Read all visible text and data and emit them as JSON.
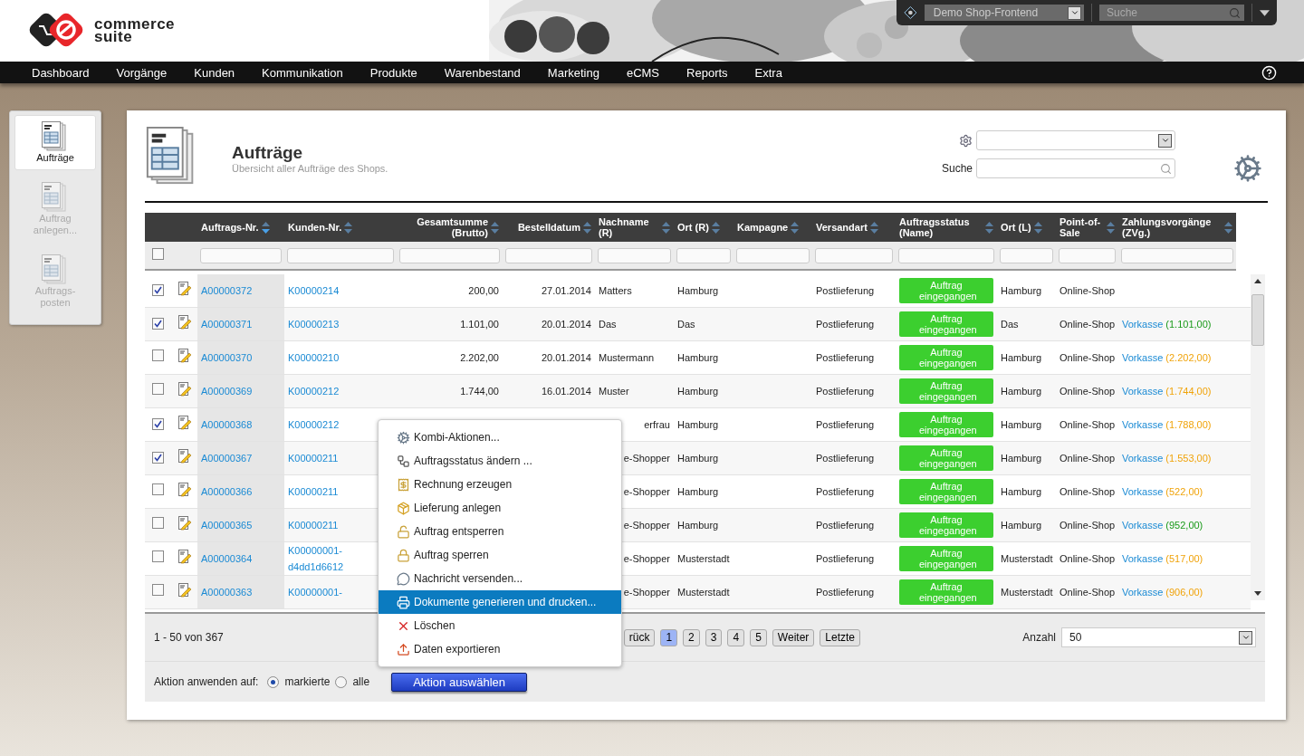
{
  "brand": {
    "line_1": "commerce",
    "line_2": "suite"
  },
  "shop_bar": {
    "shop_select": "Demo Shop-Frontend",
    "search_placeholder": "Suche"
  },
  "nav": {
    "items": [
      "Dashboard",
      "Vorgänge",
      "Kunden",
      "Kommunikation",
      "Produkte",
      "Warenbestand",
      "Marketing",
      "eCMS",
      "Reports",
      "Extra"
    ]
  },
  "sidebar": {
    "items": [
      {
        "label": "Aufträge",
        "selected": true,
        "disabled": false
      },
      {
        "label": "Auftrag anlegen...",
        "selected": false,
        "disabled": true
      },
      {
        "label": "Auftrags-posten",
        "selected": false,
        "disabled": true
      }
    ]
  },
  "page": {
    "title": "Aufträge",
    "subtitle": "Übersicht aller Aufträge des Shops.",
    "search_label": "Suche"
  },
  "table": {
    "select_all_checked": false,
    "columns": [
      {
        "label": "Auftrags-Nr.",
        "sorted": true
      },
      {
        "label": "Kunden-Nr.",
        "sorted": false
      },
      {
        "label": "Gesamtsumme (Brutto)",
        "sorted": false
      },
      {
        "label": "Bestelldatum",
        "sorted": false
      },
      {
        "label": "Nachname (R)",
        "sorted": false
      },
      {
        "label": "Ort (R)",
        "sorted": false
      },
      {
        "label": "Kampagne",
        "sorted": false
      },
      {
        "label": "Versandart",
        "sorted": false
      },
      {
        "label": "Auftragsstatus (Name)",
        "sorted": false
      },
      {
        "label": "Ort (L)",
        "sorted": false
      },
      {
        "label": "Point-of-Sale",
        "sorted": false
      },
      {
        "label": "Zahlungsvorgänge (ZVg.)",
        "sorted": false
      }
    ],
    "rows": [
      {
        "checked": true,
        "order": "A00000372",
        "customer": "K00000214",
        "total": "200,00",
        "date": "27.01.2014",
        "name": "Matters",
        "name_covered": false,
        "city_r": "Hamburg",
        "shipping": "Postlieferung",
        "status": "Auftrag eingegangen",
        "city_l": "Hamburg",
        "pos": "Online-Shop"
      },
      {
        "checked": true,
        "order": "A00000371",
        "customer": "K00000213",
        "total": "1.101,00",
        "date": "20.01.2014",
        "name": "Das",
        "name_covered": false,
        "city_r": "Das",
        "shipping": "Postlieferung",
        "status": "Auftrag eingegangen",
        "city_l": "Das",
        "pos": "Online-Shop",
        "payment": {
          "method": "Vorkasse",
          "amount": "(1.101,00)",
          "color": "#1a9a1a"
        }
      },
      {
        "checked": false,
        "order": "A00000370",
        "customer": "K00000210",
        "total": "2.202,00",
        "date": "20.01.2014",
        "name": "Mustermann",
        "name_covered": false,
        "city_r": "Hamburg",
        "shipping": "Postlieferung",
        "status": "Auftrag eingegangen",
        "city_l": "Hamburg",
        "pos": "Online-Shop",
        "payment": {
          "method": "Vorkasse",
          "amount": "(2.202,00)",
          "color": "#f0a30a"
        }
      },
      {
        "checked": false,
        "order": "A00000369",
        "customer": "K00000212",
        "total": "1.744,00",
        "date": "16.01.2014",
        "name": "Muster",
        "name_covered": false,
        "city_r": "Hamburg",
        "shipping": "Postlieferung",
        "status": "Auftrag eingegangen",
        "city_l": "Hamburg",
        "pos": "Online-Shop",
        "payment": {
          "method": "Vorkasse",
          "amount": "(1.744,00)",
          "color": "#f0a30a"
        }
      },
      {
        "checked": true,
        "order": "A00000368",
        "customer": "K00000212",
        "name": "erfrau",
        "name_covered": true,
        "city_r": "Hamburg",
        "shipping": "Postlieferung",
        "status": "Auftrag eingegangen",
        "city_l": "Hamburg",
        "pos": "Online-Shop",
        "payment": {
          "method": "Vorkasse",
          "amount": "(1.788,00)",
          "color": "#f0a30a"
        }
      },
      {
        "checked": true,
        "order": "A00000367",
        "customer": "K00000211",
        "name": "e-Shopper",
        "name_covered": true,
        "city_r": "Hamburg",
        "shipping": "Postlieferung",
        "status": "Auftrag eingegangen",
        "city_l": "Hamburg",
        "pos": "Online-Shop",
        "payment": {
          "method": "Vorkasse",
          "amount": "(1.553,00)",
          "color": "#f0a30a"
        }
      },
      {
        "checked": false,
        "order": "A00000366",
        "customer": "K00000211",
        "name": "e-Shopper",
        "name_covered": true,
        "city_r": "Hamburg",
        "shipping": "Postlieferung",
        "status": "Auftrag eingegangen",
        "city_l": "Hamburg",
        "pos": "Online-Shop",
        "payment": {
          "method": "Vorkasse",
          "amount": "(522,00)",
          "color": "#f0a30a"
        }
      },
      {
        "checked": false,
        "order": "A00000365",
        "customer": "K00000211",
        "name": "e-Shopper",
        "name_covered": true,
        "city_r": "Hamburg",
        "shipping": "Postlieferung",
        "status": "Auftrag eingegangen",
        "city_l": "Hamburg",
        "pos": "Online-Shop",
        "payment": {
          "method": "Vorkasse",
          "amount": "(952,00)",
          "color": "#1a9a1a"
        }
      },
      {
        "checked": false,
        "order": "A00000364",
        "customer": "K00000001-d4dd1d6612",
        "name": "e-Shopper",
        "name_covered": true,
        "city_r": "Musterstadt",
        "shipping": "Postlieferung",
        "status": "Auftrag eingegangen",
        "city_l": "Musterstadt",
        "pos": "Online-Shop",
        "payment": {
          "method": "Vorkasse",
          "amount": "(517,00)",
          "color": "#f0a30a"
        }
      },
      {
        "checked": false,
        "order": "A00000363",
        "customer": "K00000001-",
        "name": "e-Shopper",
        "name_covered": true,
        "city_r": "Musterstadt",
        "shipping": "Postlieferung",
        "status": "Auftrag eingegangen",
        "city_l": "Musterstadt",
        "pos": "Online-Shop",
        "payment": {
          "method": "Vorkasse",
          "amount": "(906,00)",
          "color": "#f0a30a"
        }
      }
    ]
  },
  "pagination": {
    "range": "1 - 50 von 367",
    "prev": "rück",
    "pages": [
      {
        "label": "1",
        "selected": true
      },
      {
        "label": "2",
        "selected": false
      },
      {
        "label": "3",
        "selected": false
      },
      {
        "label": "4",
        "selected": false
      },
      {
        "label": "5",
        "selected": false
      }
    ],
    "next": "Weiter",
    "last": "Letzte",
    "count_label": "Anzahl",
    "count_value": "50"
  },
  "action_bar": {
    "label": "Aktion anwenden auf:",
    "options": [
      {
        "label": "markierte",
        "selected": true
      },
      {
        "label": "alle",
        "selected": false
      }
    ],
    "button": "Aktion auswählen"
  },
  "action_menu": {
    "items": [
      {
        "label": "Kombi-Aktionen...",
        "selected": false
      },
      {
        "label": "Auftragsstatus ändern ...",
        "selected": false
      },
      {
        "label": "Rechnung erzeugen",
        "selected": false
      },
      {
        "label": "Lieferung anlegen",
        "selected": false
      },
      {
        "label": "Auftrag entsperren",
        "selected": false
      },
      {
        "label": "Auftrag sperren",
        "selected": false
      },
      {
        "label": "Nachricht versenden...",
        "selected": false
      },
      {
        "label": "Dokumente generieren und drucken...",
        "selected": true
      },
      {
        "label": "Löschen",
        "selected": false
      },
      {
        "label": "Daten exportieren",
        "selected": false
      }
    ]
  }
}
